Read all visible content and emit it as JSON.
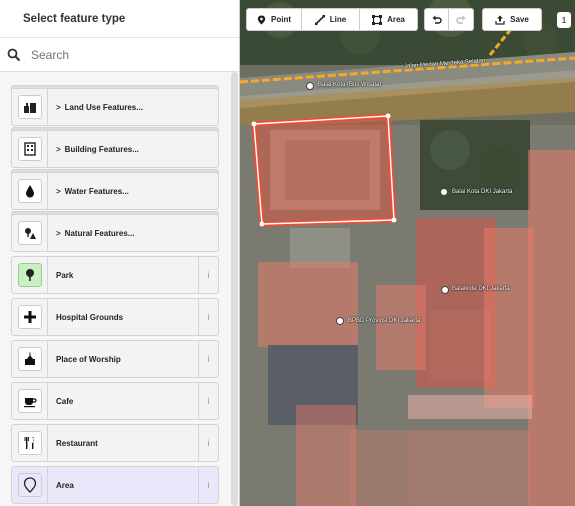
{
  "sidebar": {
    "title": "Select feature type",
    "search_placeholder": "Search",
    "presets": [
      {
        "label": "Land Use Features...",
        "icon": "landuse-icon",
        "category": true
      },
      {
        "label": "Building Features...",
        "icon": "building-icon",
        "category": true
      },
      {
        "label": "Water Features...",
        "icon": "water-drop-icon",
        "category": true
      },
      {
        "label": "Natural Features...",
        "icon": "tree-mountain-icon",
        "category": true
      },
      {
        "label": "Park",
        "icon": "park-tree-icon",
        "category": false
      },
      {
        "label": "Hospital Grounds",
        "icon": "hospital-cross-icon",
        "category": false
      },
      {
        "label": "Place of Worship",
        "icon": "worship-icon",
        "category": false
      },
      {
        "label": "Cafe",
        "icon": "cafe-cup-icon",
        "category": false
      },
      {
        "label": "Restaurant",
        "icon": "restaurant-icon",
        "category": false
      },
      {
        "label": "Area",
        "icon": "area-pin-icon",
        "category": false
      }
    ],
    "info_symbol": "i"
  },
  "toolbar": {
    "point": "Point",
    "line": "Line",
    "area": "Area",
    "save": "Save",
    "save_count": "1"
  },
  "map": {
    "street": "Jalan Medan Merdeka Selatan",
    "labels": {
      "bus": "Balai Kota (Bus Wisata)",
      "balai": "Balai Kota DKI Jakarta",
      "balaikote": "Balaikote DKI Jakarta",
      "bpbd": "BPBD Provinsi DKI Jakarta"
    }
  },
  "colors": {
    "selected_area": "#e8503a",
    "building_overlay": "#e87a6a",
    "road_orange": "#f7a828"
  }
}
